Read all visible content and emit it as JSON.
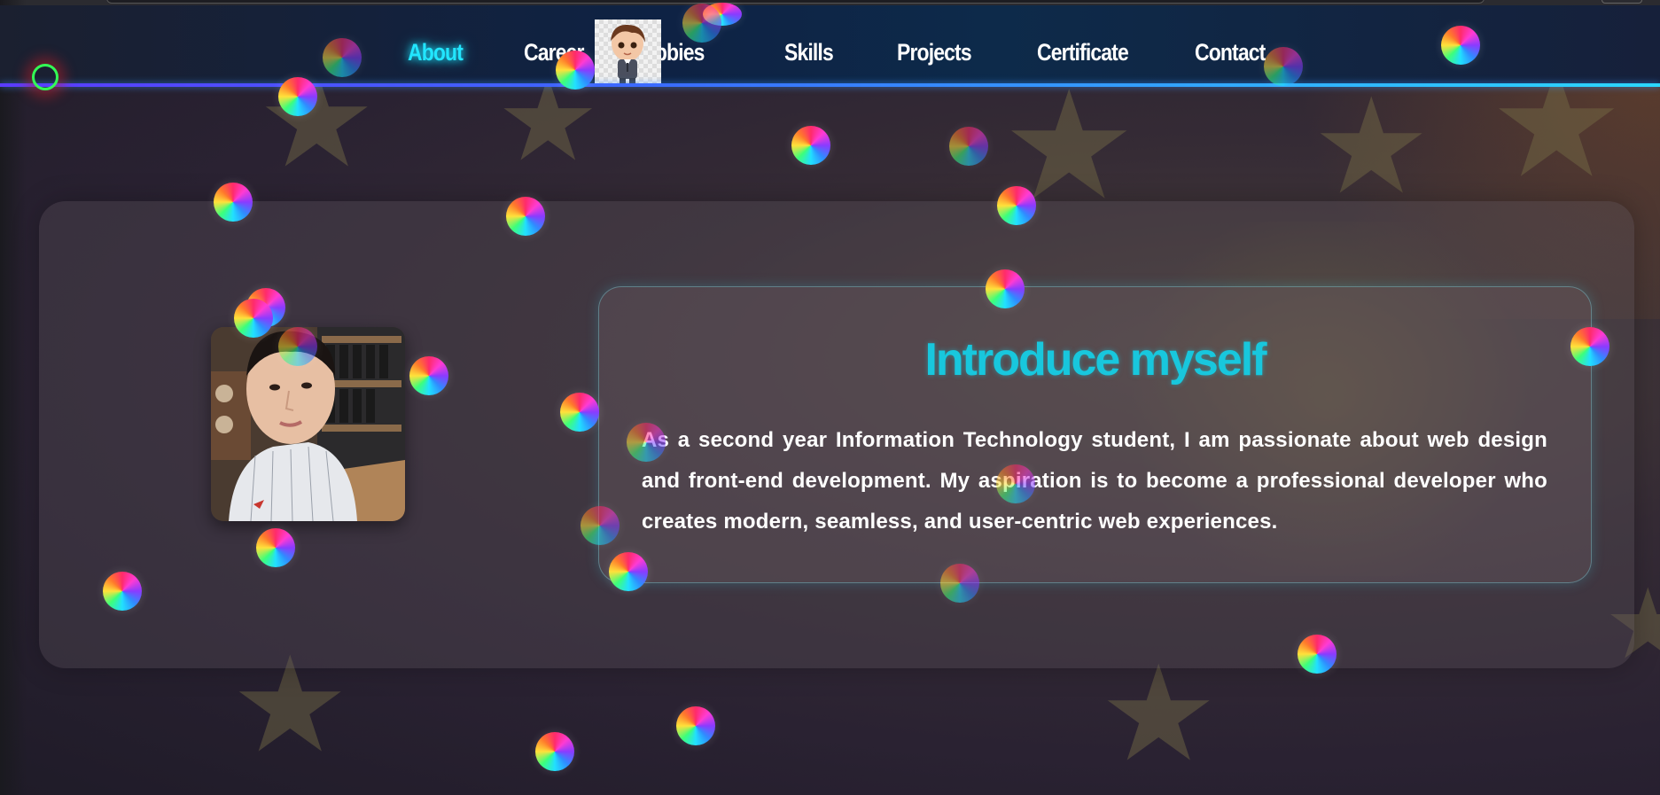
{
  "nav": {
    "items": [
      {
        "label": "About",
        "active": true
      },
      {
        "label": "Career",
        "active": false
      },
      {
        "label": "Hobbies",
        "active": false
      },
      {
        "label": "Skills",
        "active": false
      },
      {
        "label": "Projects",
        "active": false
      },
      {
        "label": "Certificate",
        "active": false
      },
      {
        "label": "Contact",
        "active": false
      }
    ],
    "avatar_icon": "chibi-avatar-icon",
    "active_color": "#22e6ff",
    "underline_colors": [
      "#5a3cff",
      "#2bd8ff"
    ]
  },
  "intro": {
    "title": "Introduce myself",
    "text": "As a second year Information Technology student, I am passionate about web design and front-end development. My aspiration is to become a professional developer who creates modern, seamless, and user-centric web experiences.",
    "title_color": "#18c7dd"
  },
  "cursor": {
    "color": "#33ff55"
  }
}
